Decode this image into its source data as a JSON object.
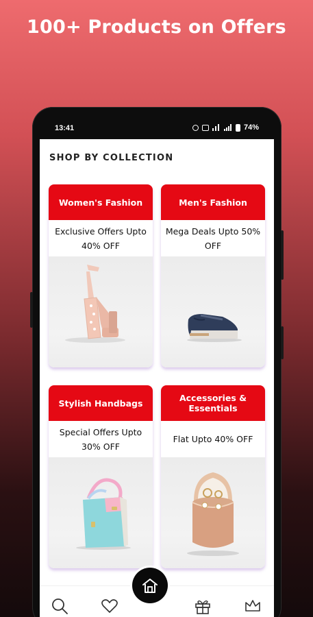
{
  "promo": {
    "title": "100+ Products on Offers"
  },
  "status_bar": {
    "time": "13:41",
    "battery": "74%"
  },
  "section": {
    "title": "SHOP BY COLLECTION"
  },
  "collections": [
    {
      "title": "Women's Fashion",
      "offer": "Exclusive Offers Upto 40% OFF",
      "image": "pink-block-heel-sandal"
    },
    {
      "title": "Men's Fashion",
      "offer": "Mega Deals Upto 50% OFF",
      "image": "navy-sneaker"
    },
    {
      "title": "Stylish Handbags",
      "offer": "Special Offers Upto 30% OFF",
      "image": "pastel-colorblock-handbag"
    },
    {
      "title": "Accessories & Essentials",
      "offer": "Flat Upto 40% OFF",
      "image": "jewelry-gift-box"
    }
  ],
  "bottom_nav": [
    {
      "name": "search",
      "icon": "search-icon"
    },
    {
      "name": "wishlist",
      "icon": "heart-icon"
    },
    {
      "name": "home",
      "icon": "home-icon"
    },
    {
      "name": "gifts",
      "icon": "gift-icon"
    },
    {
      "name": "premium",
      "icon": "crown-icon"
    }
  ],
  "colors": {
    "accent": "#e50914",
    "fab": "#0a0a0a"
  }
}
